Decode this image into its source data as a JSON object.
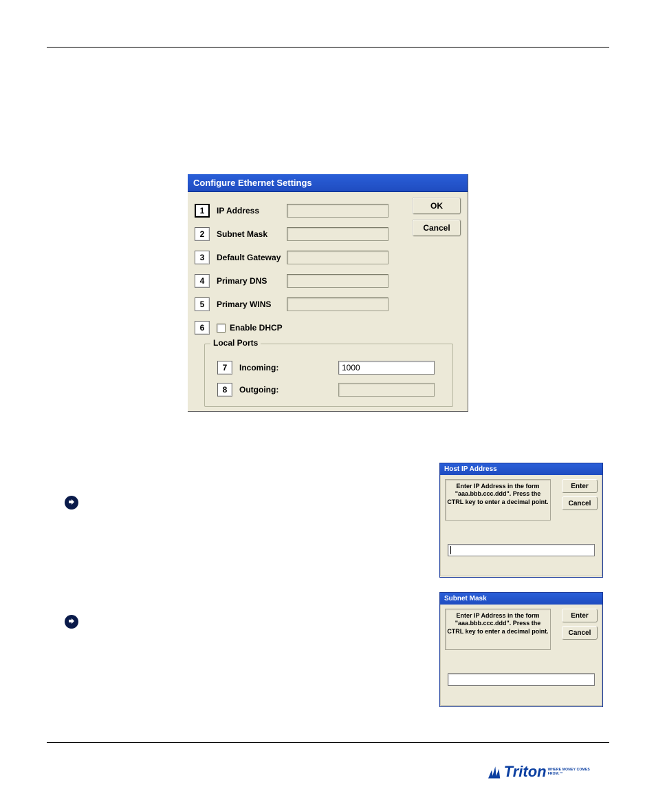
{
  "main_dialog": {
    "title": "Configure Ethernet Settings",
    "rows": [
      {
        "num": "1",
        "label": "IP Address"
      },
      {
        "num": "2",
        "label": "Subnet Mask"
      },
      {
        "num": "3",
        "label": "Default Gateway"
      },
      {
        "num": "4",
        "label": "Primary DNS"
      },
      {
        "num": "5",
        "label": "Primary WINS"
      }
    ],
    "dhcp_num": "6",
    "dhcp_label": "Enable DHCP",
    "ok": "OK",
    "cancel": "Cancel",
    "local_ports_legend": "Local Ports",
    "incoming_num": "7",
    "incoming_label": "Incoming:",
    "incoming_value": "1000",
    "outgoing_num": "8",
    "outgoing_label": "Outgoing:"
  },
  "small1": {
    "title": "Host IP Address",
    "instruction": "Enter IP Address in the form \"aaa.bbb.ccc.ddd\".  Press the CTRL key to enter a decimal point.",
    "enter": "Enter",
    "cancel": "Cancel"
  },
  "small2": {
    "title": "Subnet Mask",
    "instruction": "Enter IP Address in the form \"aaa.bbb.ccc.ddd\".  Press the CTRL key to enter a decimal point.",
    "enter": "Enter",
    "cancel": "Cancel"
  },
  "logo": {
    "text": "Triton",
    "tagline": "WHERE MONEY COMES FROM.™"
  }
}
